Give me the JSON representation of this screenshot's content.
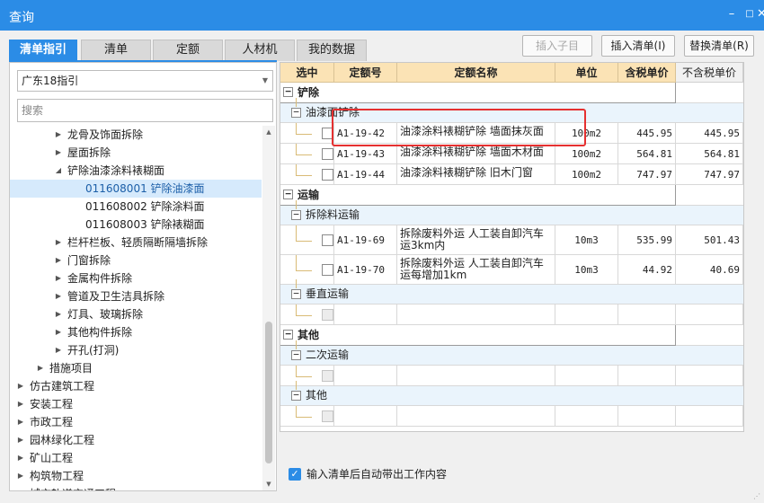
{
  "window": {
    "title": "查询"
  },
  "tabs": [
    "清单指引",
    "清单",
    "定额",
    "人材机",
    "我的数据"
  ],
  "buttons": {
    "insert_child": "插入子目",
    "insert_list": "插入清单(I)",
    "replace_list": "替换清单(R)"
  },
  "left": {
    "select_value": "广东18指引",
    "search_placeholder": "搜索",
    "tree": [
      {
        "label": "龙骨及饰面拆除",
        "indent": 64,
        "arrow": "right"
      },
      {
        "label": "屋面拆除",
        "indent": 64,
        "arrow": "right"
      },
      {
        "label": "铲除油漆涂料裱糊面",
        "indent": 64,
        "arrow": "down"
      },
      {
        "label": "011608001  铲除油漆面",
        "indent": 84,
        "arrow": "",
        "selected": true
      },
      {
        "label": "011608002  铲除涂料面",
        "indent": 84,
        "arrow": ""
      },
      {
        "label": "011608003  铲除裱糊面",
        "indent": 84,
        "arrow": ""
      },
      {
        "label": "栏杆栏板、轻质隔断隔墙拆除",
        "indent": 64,
        "arrow": "right"
      },
      {
        "label": "门窗拆除",
        "indent": 64,
        "arrow": "right"
      },
      {
        "label": "金属构件拆除",
        "indent": 64,
        "arrow": "right"
      },
      {
        "label": "管道及卫生洁具拆除",
        "indent": 64,
        "arrow": "right"
      },
      {
        "label": "灯具、玻璃拆除",
        "indent": 64,
        "arrow": "right"
      },
      {
        "label": "其他构件拆除",
        "indent": 64,
        "arrow": "right"
      },
      {
        "label": "开孔(打洞)",
        "indent": 64,
        "arrow": "right"
      },
      {
        "label": "措施项目",
        "indent": 44,
        "arrow": "right"
      },
      {
        "label": "仿古建筑工程",
        "indent": 22,
        "arrow": "right"
      },
      {
        "label": "安装工程",
        "indent": 22,
        "arrow": "right"
      },
      {
        "label": "市政工程",
        "indent": 22,
        "arrow": "right"
      },
      {
        "label": "园林绿化工程",
        "indent": 22,
        "arrow": "right"
      },
      {
        "label": "矿山工程",
        "indent": 22,
        "arrow": "right"
      },
      {
        "label": "构筑物工程",
        "indent": 22,
        "arrow": "right"
      },
      {
        "label": "城市轨道交通工程",
        "indent": 22,
        "arrow": "right"
      }
    ]
  },
  "grid": {
    "columns": [
      "选中",
      "定额号",
      "定额名称",
      "单位",
      "含税单价",
      "不含税单价"
    ],
    "rows": [
      {
        "type": "group1",
        "label": "铲除"
      },
      {
        "type": "group2",
        "label": "油漆面铲除"
      },
      {
        "type": "item",
        "code": "A1-19-42",
        "name": "油漆涂料裱糊铲除 墙面抹灰面",
        "unit": "100m2",
        "price_tax": "445.95",
        "price_notax": "445.95",
        "h": 23
      },
      {
        "type": "item",
        "code": "A1-19-43",
        "name": "油漆涂料裱糊铲除 墙面木材面",
        "unit": "100m2",
        "price_tax": "564.81",
        "price_notax": "564.81",
        "h": 23
      },
      {
        "type": "item",
        "code": "A1-19-44",
        "name": "油漆涂料裱糊铲除 旧木门窗",
        "unit": "100m2",
        "price_tax": "747.97",
        "price_notax": "747.97",
        "h": 23
      },
      {
        "type": "group1",
        "label": "运输"
      },
      {
        "type": "group2",
        "label": "拆除料运输"
      },
      {
        "type": "item",
        "code": "A1-19-69",
        "name": "拆除废料外运 人工装自卸汽车运3km内",
        "unit": "10m3",
        "price_tax": "535.99",
        "price_notax": "501.43",
        "h": 33
      },
      {
        "type": "item",
        "code": "A1-19-70",
        "name": "拆除废料外运 人工装自卸汽车运每增加1km",
        "unit": "10m3",
        "price_tax": "44.92",
        "price_notax": "40.69",
        "h": 33
      },
      {
        "type": "group2",
        "label": "垂直运输"
      },
      {
        "type": "empty",
        "h": 23
      },
      {
        "type": "group1",
        "label": "其他"
      },
      {
        "type": "group2",
        "label": "二次运输"
      },
      {
        "type": "empty",
        "h": 23
      },
      {
        "type": "group2",
        "label": "其他"
      },
      {
        "type": "empty",
        "h": 23
      }
    ]
  },
  "footer": {
    "auto_label": "输入清单后自动带出工作内容"
  },
  "colors": {
    "accent": "#2b8ce6",
    "header_bg": "#fbe3b5",
    "highlight": "#e53030"
  }
}
